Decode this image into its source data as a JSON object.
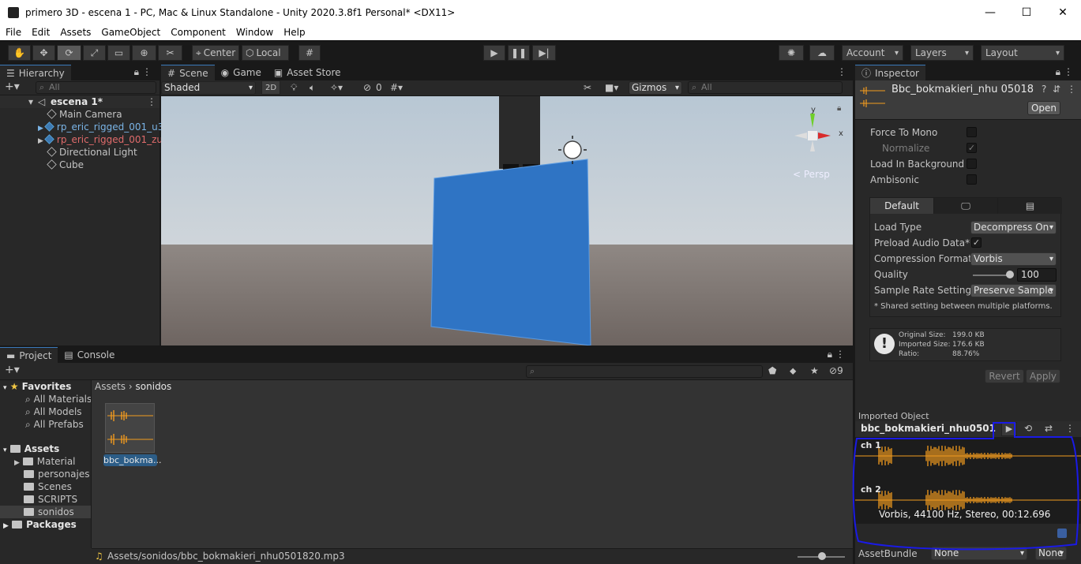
{
  "window": {
    "title": "primero 3D - escena 1 - PC, Mac & Linux Standalone - Unity 2020.3.8f1 Personal* <DX11>"
  },
  "menu": [
    "File",
    "Edit",
    "Assets",
    "GameObject",
    "Component",
    "Window",
    "Help"
  ],
  "toolbar": {
    "center": "Center",
    "local": "Local",
    "account": "Account",
    "layers": "Layers",
    "layout": "Layout"
  },
  "hierarchy": {
    "tab": "Hierarchy",
    "search_placeholder": "All",
    "scene": "escena 1*",
    "items": [
      "Main Camera",
      "rp_eric_rigged_001_u3",
      "rp_eric_rigged_001_zu",
      "Directional Light",
      "Cube"
    ]
  },
  "scene_view": {
    "tabs": [
      "Scene",
      "Game",
      "Asset Store"
    ],
    "shading": "Shaded",
    "mode_2d": "2D",
    "hidden_count": "0",
    "gizmos": "Gizmos",
    "search_placeholder": "All",
    "persp": "Persp",
    "axis_x": "x",
    "axis_y": "y"
  },
  "project": {
    "tabs": [
      "Project",
      "Console"
    ],
    "hidden_count": "9",
    "favorites_label": "Favorites",
    "favorites": [
      "All Materials",
      "All Models",
      "All Prefabs"
    ],
    "assets_label": "Assets",
    "folders": [
      "Material",
      "personajes",
      "Scenes",
      "SCRIPTS",
      "sonidos"
    ],
    "packages_label": "Packages",
    "breadcrumb": [
      "Assets",
      "sonidos"
    ],
    "asset_name": "bbc_bokma...",
    "status_path": "Assets/sonidos/bbc_bokmakieri_nhu0501820.mp3"
  },
  "inspector": {
    "tab": "Inspector",
    "title": "Bbc_bokmakieri_nhu 05018",
    "open_button": "Open",
    "force_to_mono": "Force To Mono",
    "normalize": "Normalize",
    "load_in_background": "Load In Background",
    "ambisonic": "Ambisonic",
    "platform_tab_default": "Default",
    "load_type_label": "Load Type",
    "load_type": "Decompress On",
    "preload_label": "Preload Audio Data*",
    "compression_label": "Compression Format",
    "compression": "Vorbis",
    "quality_label": "Quality",
    "quality": "100",
    "sample_rate_label": "Sample Rate Setting",
    "sample_rate": "Preserve Sample",
    "shared_note": "* Shared setting between multiple platforms.",
    "info": {
      "original_label": "Original Size:",
      "original": "199.0 KB",
      "imported_label": "Imported Size:",
      "imported": "176.6 KB",
      "ratio_label": "Ratio:",
      "ratio": "88.76%"
    },
    "revert": "Revert",
    "apply": "Apply",
    "imported_object": "Imported Object",
    "preview_title": "bbc_bokmakieri_nhu0501",
    "ch1": "ch 1",
    "ch2": "ch 2",
    "audio_info": "Vorbis, 44100 Hz, Stereo, 00:12.696",
    "asset_bundle_label": "AssetBundle",
    "asset_bundle": "None",
    "asset_variant": "None"
  },
  "colors": {
    "accent": "#3a79bb",
    "waveform": "#f29b1e",
    "annotation": "#1a1ae6"
  }
}
